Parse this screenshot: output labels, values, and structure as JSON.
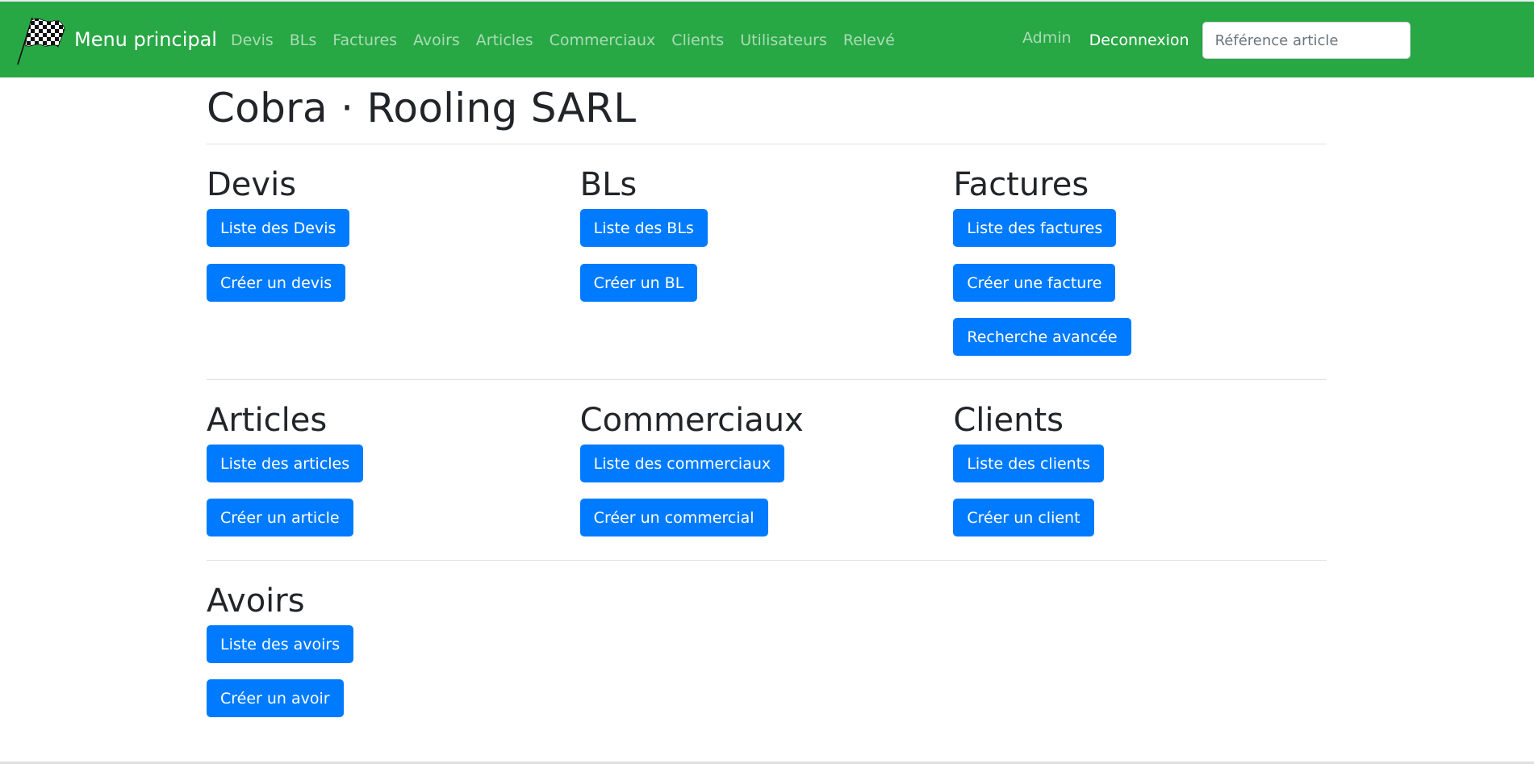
{
  "navbar": {
    "brand_label": "Menu principal",
    "brand_icon": "checkered-flag-icon",
    "links": [
      "Devis",
      "BLs",
      "Factures",
      "Avoirs",
      "Articles",
      "Commerciaux",
      "Clients",
      "Utilisateurs",
      "Relevé"
    ],
    "admin_label": "Admin",
    "logout_label": "Deconnexion",
    "search_placeholder": "Référence article",
    "background_color": "#28a745"
  },
  "page": {
    "title": "Cobra · Rooling SARL"
  },
  "sections": {
    "devis": {
      "title": "Devis",
      "buttons": [
        "Liste des Devis",
        "Créer un devis"
      ]
    },
    "bls": {
      "title": "BLs",
      "buttons": [
        "Liste des BLs",
        "Créer un BL"
      ]
    },
    "factures": {
      "title": "Factures",
      "buttons": [
        "Liste des factures",
        "Créer une facture",
        "Recherche avancée"
      ]
    },
    "articles": {
      "title": "Articles",
      "buttons": [
        "Liste des articles",
        "Créer un article"
      ]
    },
    "commerciaux": {
      "title": "Commerciaux",
      "buttons": [
        "Liste des commerciaux",
        "Créer un commercial"
      ]
    },
    "clients": {
      "title": "Clients",
      "buttons": [
        "Liste des clients",
        "Créer un client"
      ]
    },
    "avoirs": {
      "title": "Avoirs",
      "buttons": [
        "Liste des avoirs",
        "Créer un avoir"
      ]
    }
  },
  "colors": {
    "button_primary": "#007bff",
    "title_text": "#212529"
  }
}
